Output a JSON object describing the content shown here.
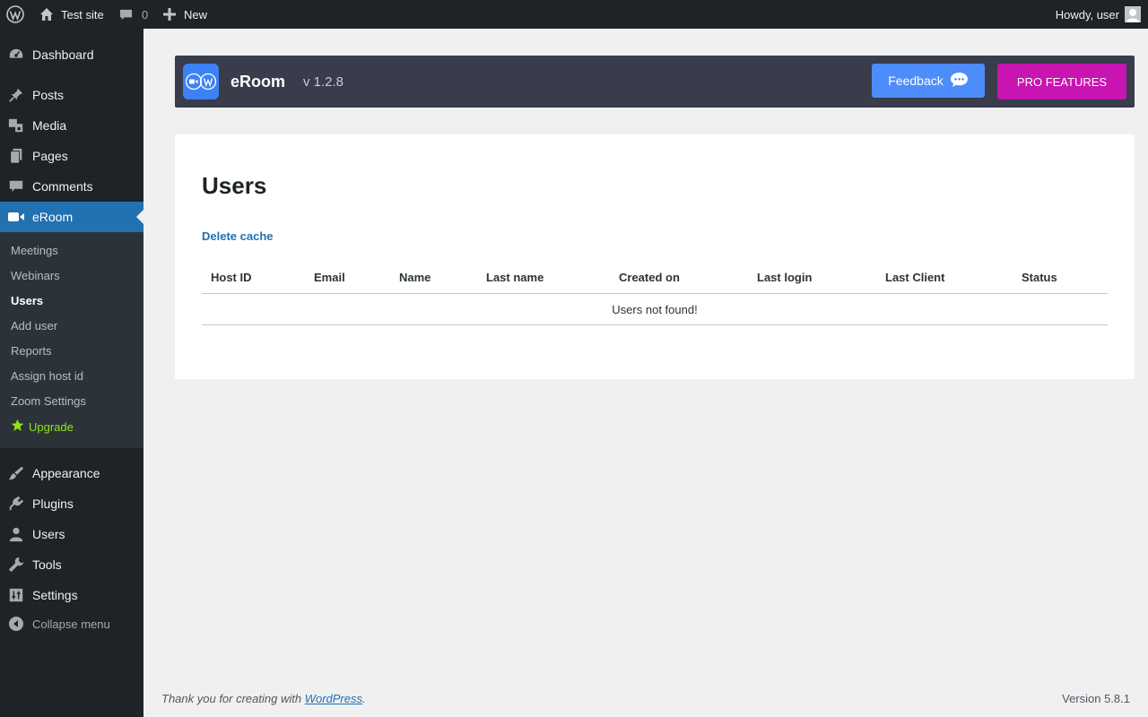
{
  "adminbar": {
    "site_name": "Test site",
    "comments_count": "0",
    "new_label": "New",
    "howdy": "Howdy, user"
  },
  "sidebar": {
    "items": [
      {
        "label": "Dashboard",
        "icon": "dashboard-icon"
      },
      {
        "label": "Posts",
        "icon": "pin-icon"
      },
      {
        "label": "Media",
        "icon": "media-icon"
      },
      {
        "label": "Pages",
        "icon": "pages-icon"
      },
      {
        "label": "Comments",
        "icon": "comment-icon"
      },
      {
        "label": "eRoom",
        "icon": "video-camera-icon"
      },
      {
        "label": "Appearance",
        "icon": "paintbrush-icon"
      },
      {
        "label": "Plugins",
        "icon": "plugin-icon"
      },
      {
        "label": "Users",
        "icon": "user-icon"
      },
      {
        "label": "Tools",
        "icon": "wrench-icon"
      },
      {
        "label": "Settings",
        "icon": "sliders-icon"
      }
    ],
    "submenu": [
      "Meetings",
      "Webinars",
      "Users",
      "Add user",
      "Reports",
      "Assign host id",
      "Zoom Settings",
      "Upgrade"
    ],
    "collapse_label": "Collapse menu"
  },
  "header": {
    "brand": "eRoom",
    "version": "v 1.2.8",
    "feedback_label": "Feedback",
    "pro_label": "PRO FEATURES"
  },
  "main": {
    "title": "Users",
    "delete_cache": "Delete cache",
    "columns": [
      "Host ID",
      "Email",
      "Name",
      "Last name",
      "Created on",
      "Last login",
      "Last Client",
      "Status"
    ],
    "empty_message": "Users not found!"
  },
  "footer": {
    "thanks_prefix": "Thank you for creating with ",
    "thanks_link": "WordPress",
    "thanks_suffix": ".",
    "version": "Version 5.8.1"
  },
  "colors": {
    "accent": "#2271b1",
    "header_bg": "#393c4b",
    "feedback": "#4d8dfb",
    "pro": "#c814b0",
    "upgrade": "#8ee51a"
  }
}
